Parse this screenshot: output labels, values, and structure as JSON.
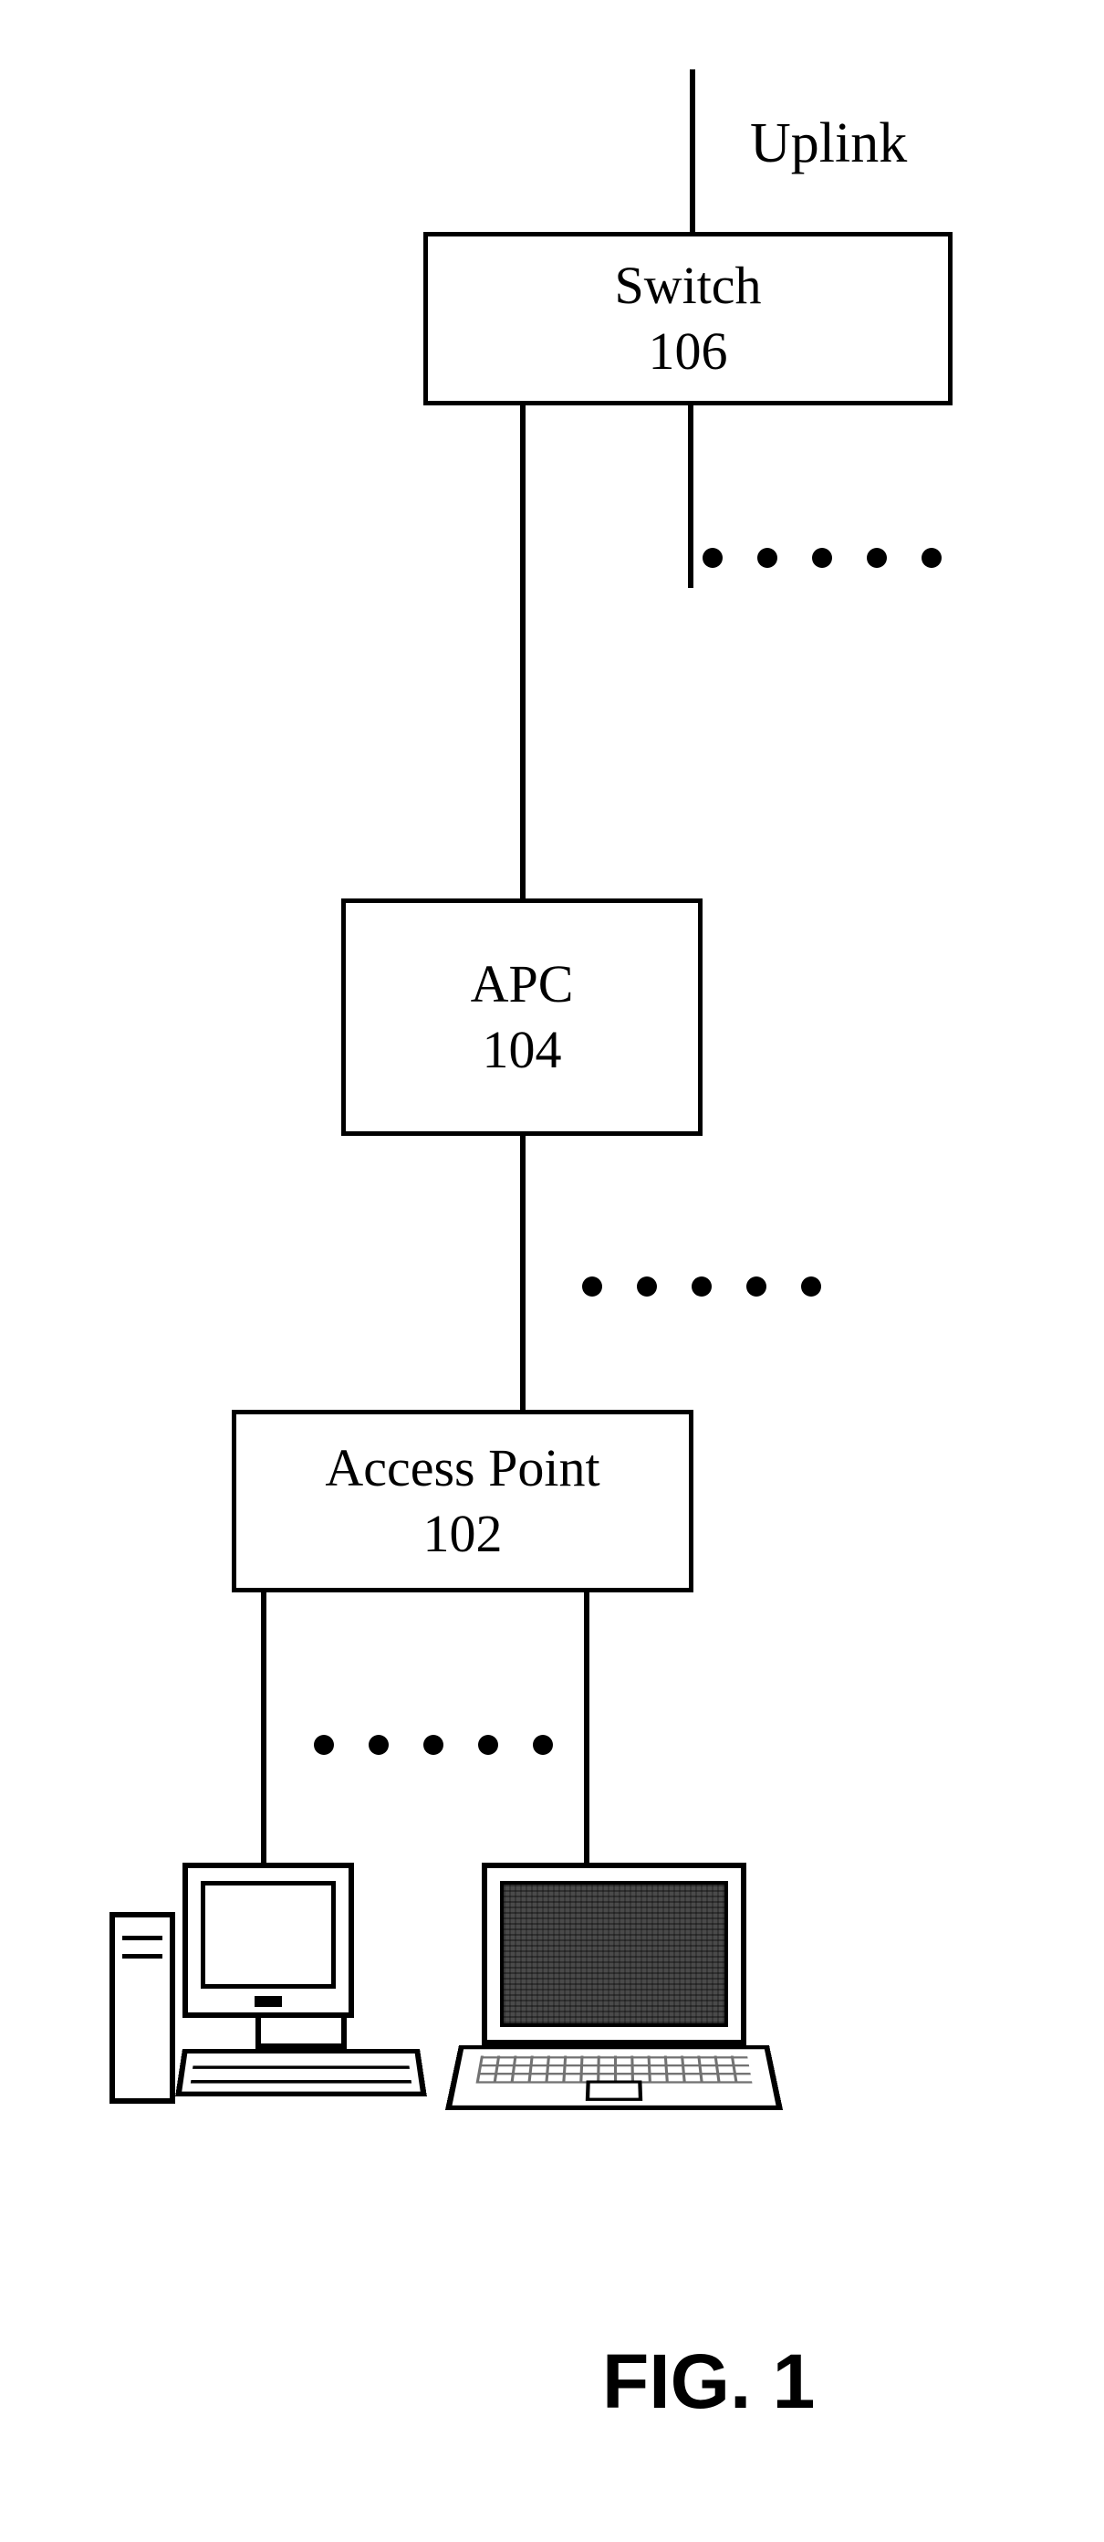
{
  "uplink_label": "Uplink",
  "switch": {
    "name": "Switch",
    "ref": "106"
  },
  "apc": {
    "name": "APC",
    "ref": "104"
  },
  "ap": {
    "name": "Access Point",
    "ref": "102"
  },
  "figure_caption": "FIG. 1"
}
